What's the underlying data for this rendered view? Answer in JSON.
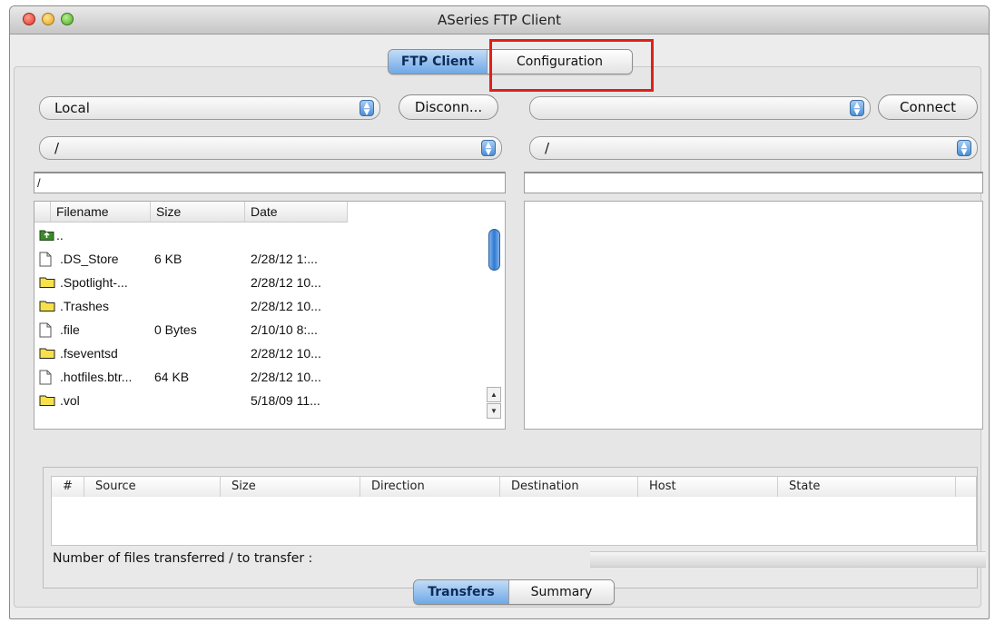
{
  "window": {
    "title": "ASeries FTP Client"
  },
  "tabs": {
    "ftp_client": "FTP Client",
    "configuration": "Configuration"
  },
  "left": {
    "location_select": "Local",
    "disconnect_button": "Disconn...",
    "dir_select": "/",
    "path": "/",
    "columns": [
      "Filename",
      "Size",
      "Date"
    ],
    "parent_label": "..",
    "files": [
      {
        "icon": "file-icon",
        "name": ".DS_Store",
        "size": "6 KB",
        "date": "2/28/12 1:..."
      },
      {
        "icon": "folder-icon",
        "name": ".Spotlight-...",
        "size": "",
        "date": "2/28/12 10..."
      },
      {
        "icon": "folder-icon",
        "name": ".Trashes",
        "size": "",
        "date": "2/28/12 10..."
      },
      {
        "icon": "file-icon",
        "name": ".file",
        "size": "0 Bytes",
        "date": "2/10/10 8:..."
      },
      {
        "icon": "folder-icon",
        "name": ".fseventsd",
        "size": "",
        "date": "2/28/12 10..."
      },
      {
        "icon": "file-icon",
        "name": ".hotfiles.btr...",
        "size": "64 KB",
        "date": "2/28/12 10..."
      },
      {
        "icon": "folder-icon",
        "name": ".vol",
        "size": "",
        "date": "5/18/09 11..."
      }
    ]
  },
  "right": {
    "host_select": "",
    "connect_button": "Connect",
    "dir_select": "/",
    "path": ""
  },
  "transfers": {
    "columns": [
      "#",
      "Source",
      "Size",
      "Direction",
      "Destination",
      "Host",
      "State"
    ],
    "status_label": "Number of files transferred / to transfer :"
  },
  "bottom_tabs": {
    "transfers": "Transfers",
    "summary": "Summary"
  },
  "colors": {
    "selected_tab": "#6ea8e6",
    "highlight_box": "#e0201a"
  }
}
